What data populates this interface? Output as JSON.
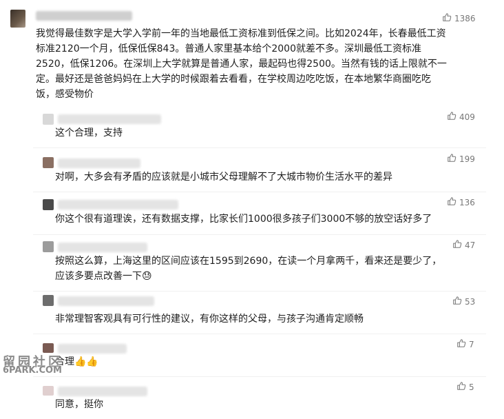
{
  "comments": [
    {
      "likes": "1386",
      "lines": [
        "我觉得最佳数字是大学入学前一年的当地最低工资标准到低保之间。比如2024年，长春最低工资",
        "标准2120一个月，低保低保843。普通人家里基本给个2000就差不多。深圳最低工资标准",
        "2520，低保1206。在深圳上大学就算是普通人家，最起码也得2500。当然有钱的话上限就不一",
        "定。最好还是爸爸妈妈在上大学的时候跟着去看看，在学校周边吃吃饭，在本地繁华商圈吃吃",
        "饭，感受物价"
      ]
    },
    {
      "likes": "409",
      "lines": [
        "这个合理，支持"
      ]
    },
    {
      "likes": "199",
      "lines": [
        "对啊，大多会有矛盾的应该就是小城市父母理解不了大城市物价生活水平的差异"
      ]
    },
    {
      "likes": "136",
      "lines": [
        "你这个很有道理诶，还有数据支撑，比家长们1000很多孩子们3000不够的放空话好多了"
      ]
    },
    {
      "likes": "47",
      "lines": [
        "按照这么算，上海这里的区间应该在1595到2690，在读一个月拿两千，看来还是要少了，",
        "应该多要点改善一下😓"
      ]
    },
    {
      "likes": "53",
      "lines": [
        "非常理智客观具有可行性的建议，有你这样的父母，与孩子沟通肯定顺畅"
      ]
    },
    {
      "likes": "7",
      "lines": [
        "合理👍👍"
      ]
    },
    {
      "likes": "5",
      "lines": [
        "同意，挺你"
      ]
    }
  ],
  "watermark": {
    "line1": "留园社区",
    "line2": "6PARK.COM"
  }
}
